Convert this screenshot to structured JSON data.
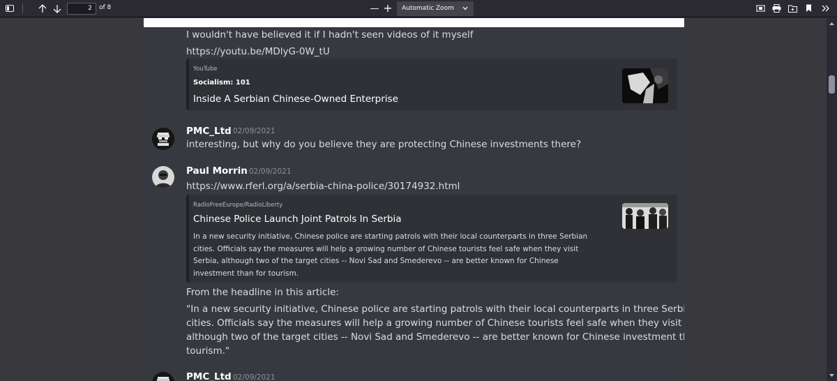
{
  "toolbar": {
    "page_number": "2",
    "page_count": "of 8",
    "zoom": "Automatic Zoom",
    "zoom_minus": "—",
    "zoom_plus": "+"
  },
  "messages": [
    {
      "lines": [
        "I wouldn't have believed it if I hadn't seen videos of it myself",
        "https://youtu.be/MDlyG-0W_tU"
      ]
    },
    {
      "author": "PMC_Ltd",
      "timestamp": "02/09/2021",
      "text": "interesting, but why do you believe they are protecting Chinese investments there?"
    },
    {
      "author": "Paul Morrin",
      "timestamp": "02/09/2021",
      "text": "https://www.rferl.org/a/serbia-china-police/30174932.html"
    },
    {
      "author": "PMC_Ltd",
      "timestamp": "02/09/2021"
    }
  ],
  "embeds": {
    "youtube": {
      "provider": "YouTube",
      "author": "Socialism: 101",
      "title": "Inside A Serbian Chinese-Owned Enterprise"
    },
    "rferl": {
      "provider": "RadioFreeEurope/RadioLiberty",
      "title": "Chinese Police Launch Joint Patrols In Serbia",
      "description": [
        "In a new security initiative, Chinese police are starting patrols with their local counterparts in three Serbian",
        "cities. Officials say the measures will help a growing number of Chinese tourists feel safe when they visit",
        "Serbia, although two of the target cities -- Novi Sad and Smederevo -- are better known for Chinese",
        "investment than for tourism."
      ]
    }
  },
  "followup": {
    "intro": "From the headline in this article:",
    "quote": [
      "\"In a new security initiative, Chinese police are starting patrols with their local counterparts in three Serbian",
      "cities. Officials say the measures will help a growing number of Chinese tourists feel safe when they visit Serbia,",
      "although two of the target cities -- Novi Sad and Smederevo -- are better known for Chinese investment than for",
      "tourism.\""
    ]
  }
}
